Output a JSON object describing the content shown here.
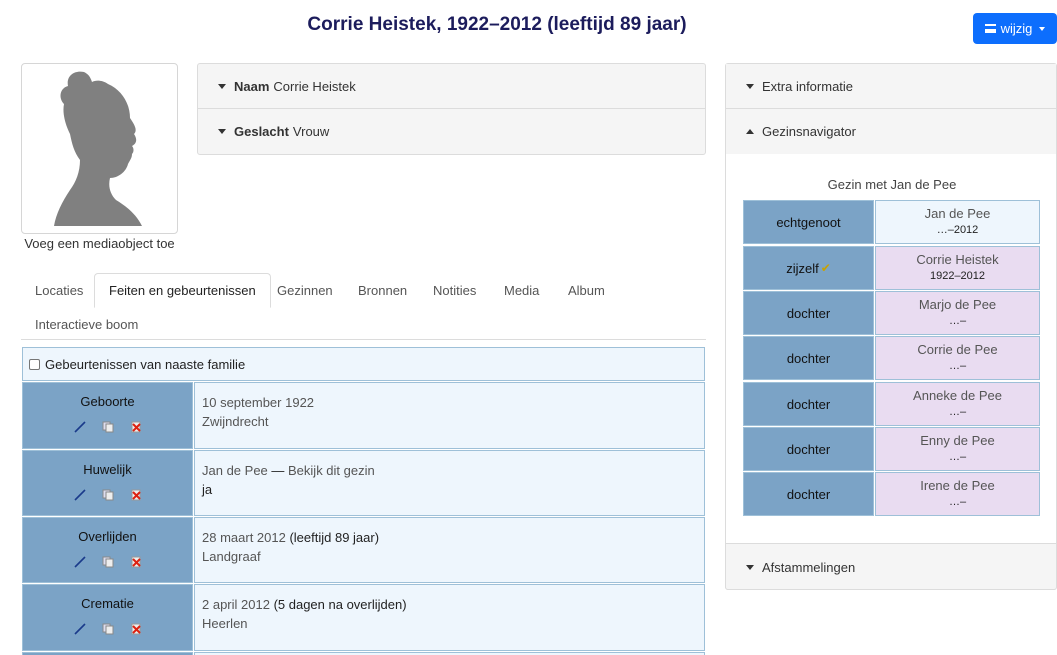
{
  "header": {
    "title": "Corrie Heistek, 1922–2012 (leeftijd 89 jaar)",
    "edit_label": "wijzig"
  },
  "photo": {
    "caption": "Voeg een mediaobject toe"
  },
  "details": [
    {
      "label": "Naam",
      "value": "Corrie Heistek"
    },
    {
      "label": "Geslacht",
      "value": "Vrouw"
    }
  ],
  "tabs": [
    "Locaties",
    "Feiten en gebeurtenissen",
    "Gezinnen",
    "Bronnen",
    "Notities",
    "Media",
    "Album",
    "Interactieve boom"
  ],
  "active_tab": "Feiten en gebeurtenissen",
  "facts_toggle": "Gebeurtenissen van naaste familie",
  "facts": [
    {
      "label": "Geboorte",
      "line1": "10 september 1922",
      "line1_extra": "",
      "line2": "Zwijndrecht"
    },
    {
      "label": "Huwelijk",
      "line1": "Jan de Pee",
      "line1_extra": " — ",
      "line1_link": "Bekijk dit gezin",
      "line2": "ja"
    },
    {
      "label": "Overlijden",
      "line1": "28 maart 2012",
      "line1_extra": " (leeftijd 89 jaar)",
      "line2": "Landgraaf"
    },
    {
      "label": "Crematie",
      "line1": "2 april 2012",
      "line1_extra": " (5 dagen na overlijden)",
      "line2": "Heerlen"
    }
  ],
  "sidebar": {
    "extra_info": "Extra informatie",
    "navigator": "Gezinsnavigator",
    "descendants": "Afstammelingen",
    "family_caption": "Gezin met Jan de Pee",
    "family": [
      {
        "role": "echtgenoot",
        "name": "Jan de Pee",
        "dates": "…–2012",
        "sex": "male"
      },
      {
        "role": "zijzelf",
        "name": "Corrie Heistek",
        "dates": "1922–2012",
        "sex": "female"
      },
      {
        "role": "dochter",
        "name": "Marjo de Pee",
        "dates": "…–",
        "sex": "female"
      },
      {
        "role": "dochter",
        "name": "Corrie de Pee",
        "dates": "…–",
        "sex": "female"
      },
      {
        "role": "dochter",
        "name": "Anneke de Pee",
        "dates": "…–",
        "sex": "female"
      },
      {
        "role": "dochter",
        "name": "Enny de Pee",
        "dates": "…–",
        "sex": "female"
      },
      {
        "role": "dochter",
        "name": "Irene de Pee",
        "dates": "…–",
        "sex": "female"
      }
    ]
  }
}
